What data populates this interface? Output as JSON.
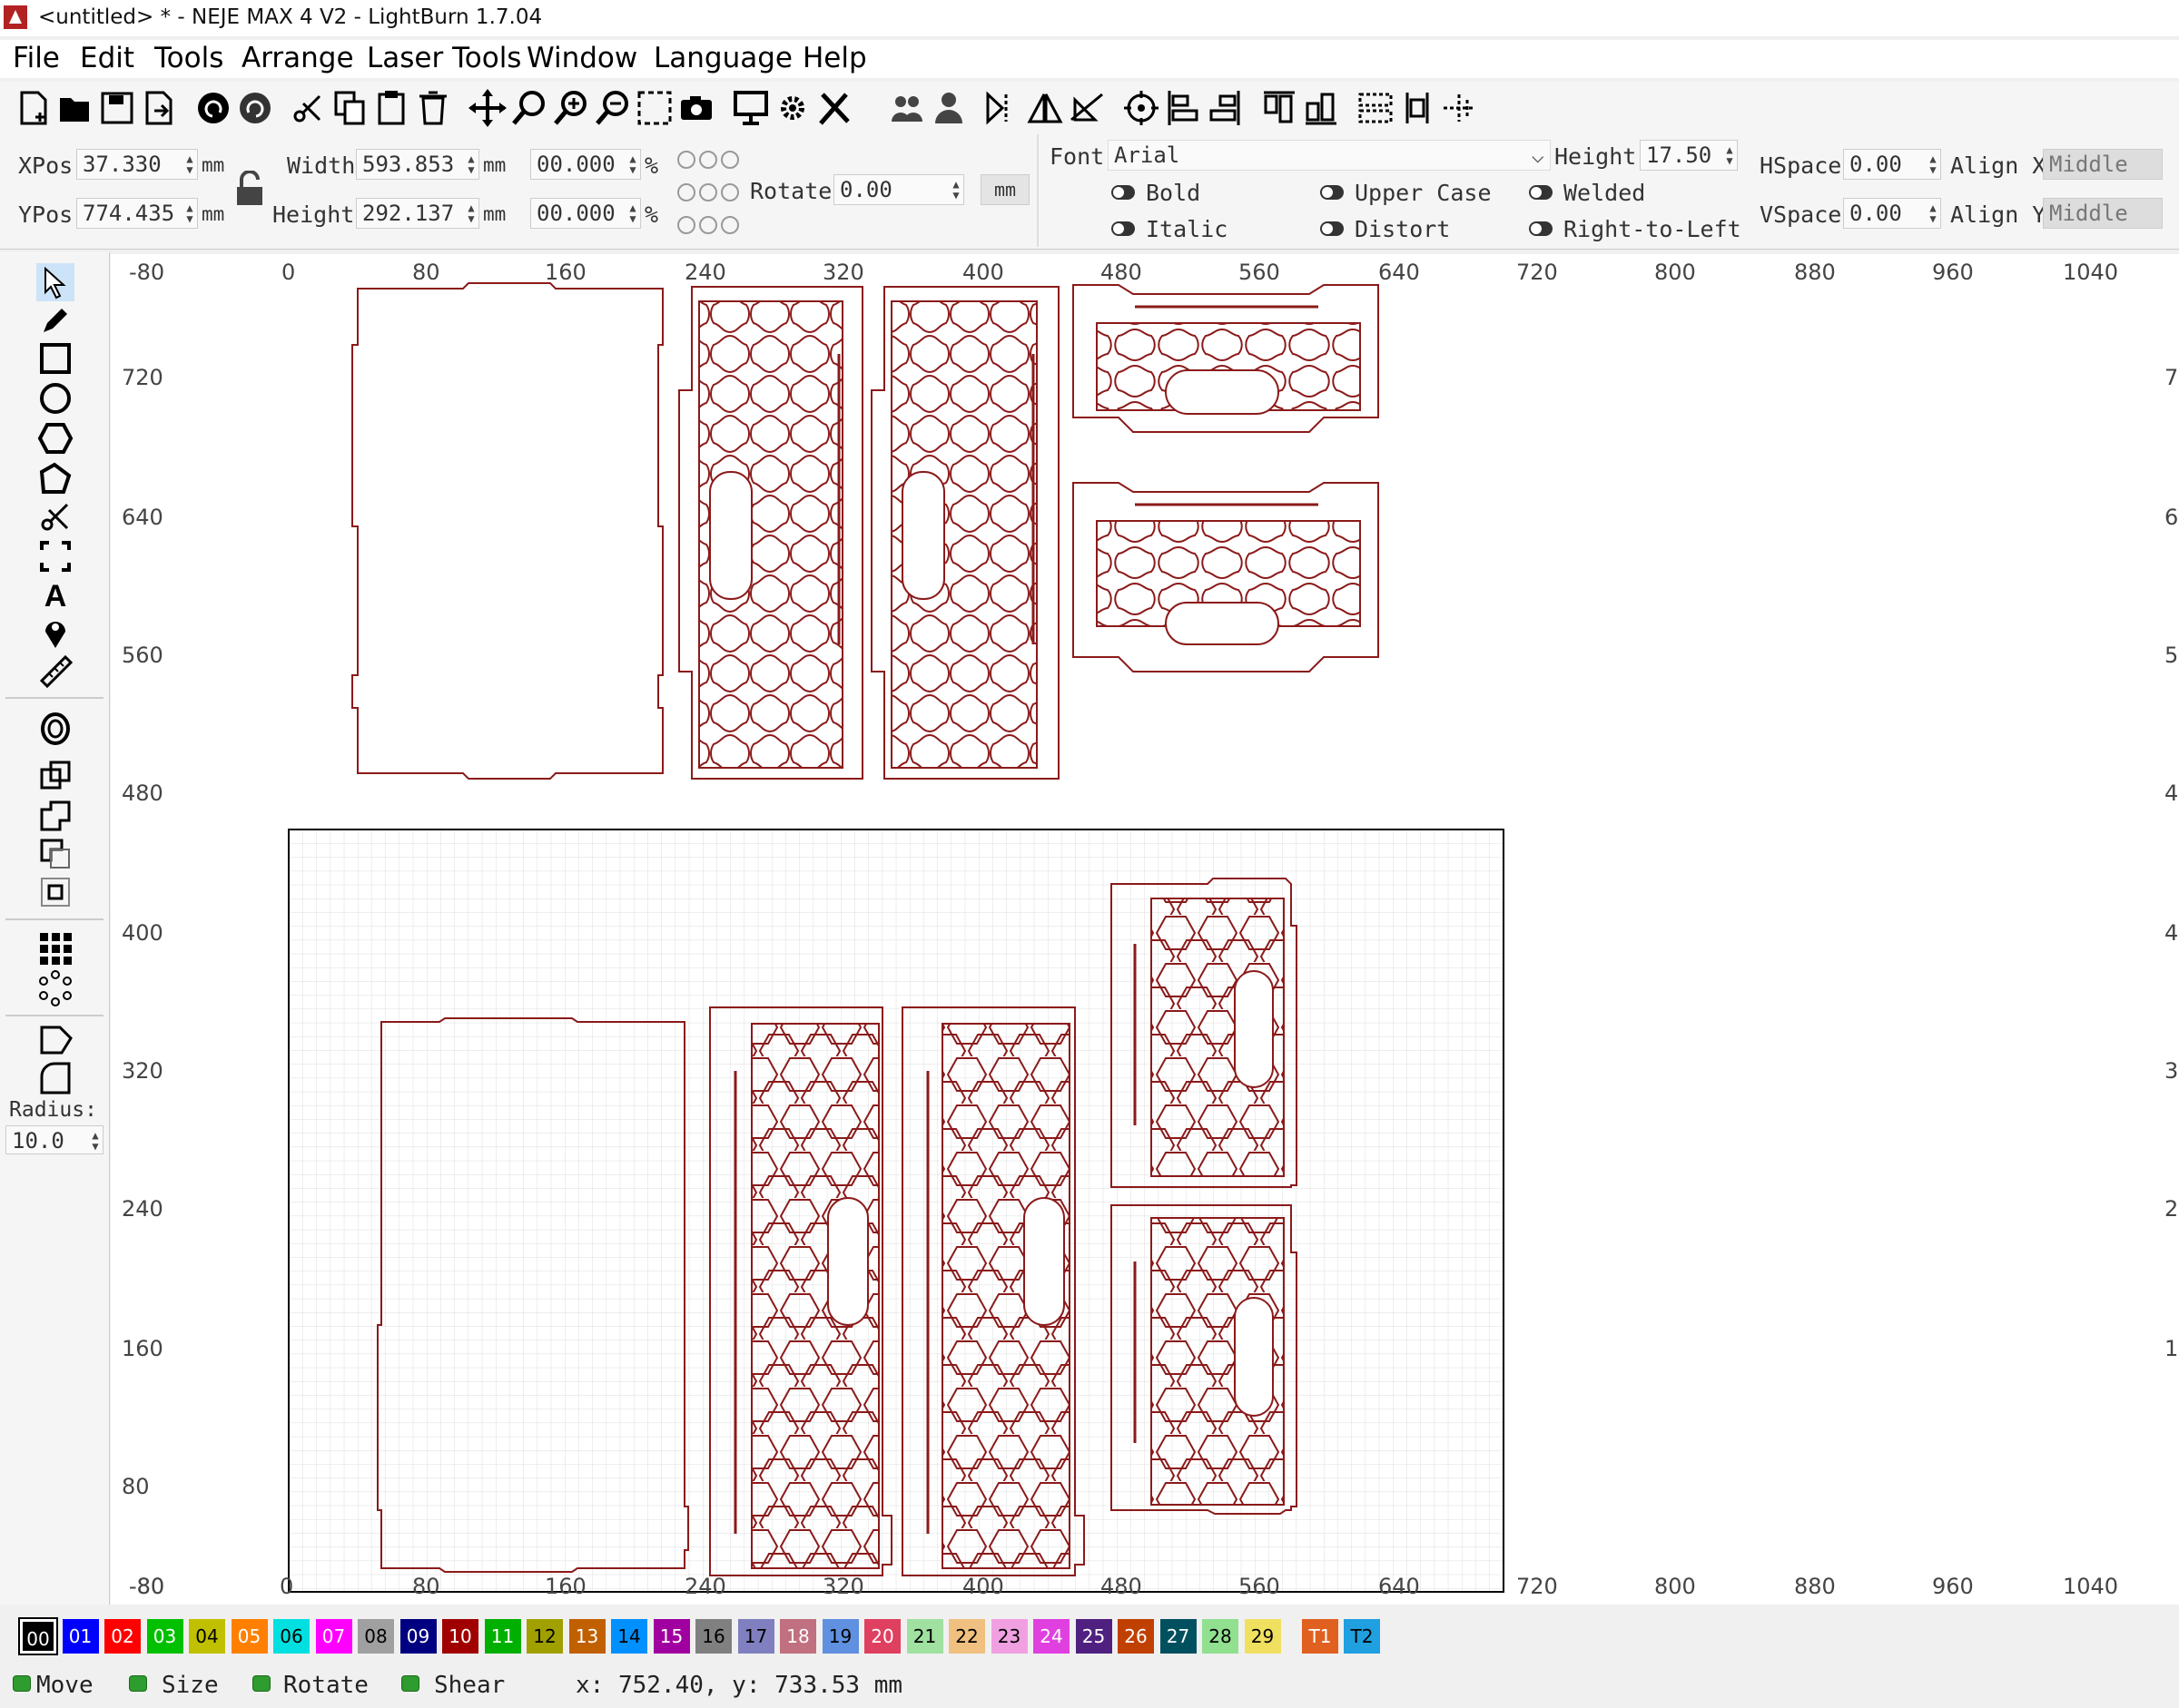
{
  "window": {
    "title": "<untitled> * - NEJE MAX 4 V2 - LightBurn 1.7.04"
  },
  "menu": [
    "File",
    "Edit",
    "Tools",
    "Arrange",
    "Laser Tools",
    "Window",
    "Language",
    "Help"
  ],
  "props": {
    "xpos_label": "XPos",
    "xpos_value": "37.330",
    "ypos_label": "YPos",
    "ypos_value": "774.435",
    "unit": "mm",
    "width_label": "Width",
    "width_value": "593.853",
    "height_label": "Height",
    "height_value": "292.137",
    "width_pct": "00.000",
    "height_pct": "00.000",
    "pct": "%",
    "rotate_label": "Rotate",
    "rotate_value": "0.00",
    "mm_button": "mm"
  },
  "text_props": {
    "font_label": "Font",
    "font_value": "Arial",
    "height_label": "Height",
    "height_value": "17.50",
    "hspace_label": "HSpace",
    "hspace_value": "0.00",
    "vspace_label": "VSpace",
    "vspace_value": "0.00",
    "alignx_label": "Align X",
    "alignx_value": "Middle",
    "aligny_label": "Align Y",
    "aligny_value": "Middle",
    "bold": "Bold",
    "italic": "Italic",
    "upper_case": "Upper Case",
    "distort": "Distort",
    "welded": "Welded",
    "rtl": "Right-to-Left"
  },
  "leftbar": {
    "radius_label": "Radius:",
    "radius_value": "10.0"
  },
  "ruler": {
    "top": [
      "-80",
      "0",
      "80",
      "160",
      "240",
      "320",
      "400",
      "480",
      "560",
      "640",
      "720",
      "800",
      "880",
      "960",
      "1040"
    ],
    "bottom": [
      "-80",
      "0",
      "80",
      "160",
      "240",
      "320",
      "400",
      "480",
      "560",
      "640",
      "720",
      "800",
      "880",
      "960",
      "1040"
    ],
    "left": [
      "720",
      "640",
      "560",
      "480",
      "400",
      "320",
      "240",
      "160",
      "80",
      "-80"
    ],
    "right_digits": [
      "7",
      "6",
      "5",
      "4",
      "4",
      "3",
      "2",
      "1"
    ]
  },
  "palette": [
    {
      "label": "00",
      "color": "#000000"
    },
    {
      "label": "01",
      "color": "#0000ff"
    },
    {
      "label": "02",
      "color": "#ff0000"
    },
    {
      "label": "03",
      "color": "#00c000"
    },
    {
      "label": "04",
      "color": "#c0c000"
    },
    {
      "label": "05",
      "color": "#ff8000"
    },
    {
      "label": "06",
      "color": "#00e0e0"
    },
    {
      "label": "07",
      "color": "#ff00ff"
    },
    {
      "label": "08",
      "color": "#a0a0a0"
    },
    {
      "label": "09",
      "color": "#000080"
    },
    {
      "label": "10",
      "color": "#a00000"
    },
    {
      "label": "11",
      "color": "#00b000"
    },
    {
      "label": "12",
      "color": "#a0a000"
    },
    {
      "label": "13",
      "color": "#c06000"
    },
    {
      "label": "14",
      "color": "#0090ff"
    },
    {
      "label": "15",
      "color": "#a000a0"
    },
    {
      "label": "16",
      "color": "#808080"
    },
    {
      "label": "17",
      "color": "#8080c0"
    },
    {
      "label": "18",
      "color": "#c07080"
    },
    {
      "label": "19",
      "color": "#6090e0"
    },
    {
      "label": "20",
      "color": "#e04060"
    },
    {
      "label": "21",
      "color": "#a0e0a0"
    },
    {
      "label": "22",
      "color": "#f0c080"
    },
    {
      "label": "23",
      "color": "#f0a0e0"
    },
    {
      "label": "24",
      "color": "#e040e0"
    },
    {
      "label": "25",
      "color": "#502080"
    },
    {
      "label": "26",
      "color": "#c04000"
    },
    {
      "label": "27",
      "color": "#005060"
    },
    {
      "label": "28",
      "color": "#90e090"
    },
    {
      "label": "29",
      "color": "#f0e060"
    },
    {
      "label": "T1",
      "color": "#e06020"
    },
    {
      "label": "T2",
      "color": "#20a0e0"
    }
  ],
  "status": {
    "move": "Move",
    "size": "Size",
    "rotate": "Rotate",
    "shear": "Shear",
    "coords": "x: 752.40, y: 733.53 mm"
  },
  "colors": {
    "cut_line": "#8b1a1a",
    "grid": "#d8d8d8",
    "accent": "#2e9c2e"
  }
}
